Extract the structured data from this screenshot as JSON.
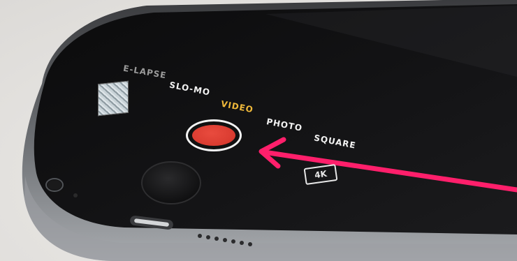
{
  "camera": {
    "modes": [
      "E-LAPSE",
      "SLO-MO",
      "VIDEO",
      "PHOTO",
      "SQUARE"
    ],
    "active_mode": "VIDEO",
    "resolution_badge": "4K",
    "record_color": "#d93b30"
  },
  "annotation": {
    "arrow_color": "#ff1f6b"
  },
  "icons": [
    "last-photo-thumbnail-icon",
    "record-button-icon",
    "home-button-icon",
    "arrow-icon"
  ]
}
